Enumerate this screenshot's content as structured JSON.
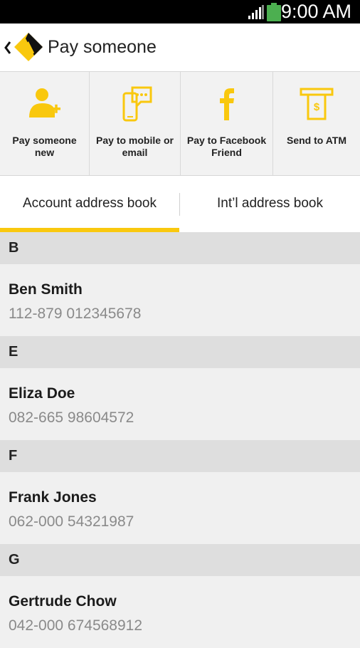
{
  "status_bar": {
    "time": "9:00 AM"
  },
  "app_bar": {
    "title": "Pay someone"
  },
  "actions": [
    {
      "label": "Pay someone new",
      "icon": "add-person-icon"
    },
    {
      "label": "Pay to mobile or email",
      "icon": "mobile-chat-icon"
    },
    {
      "label": "Pay to Facebook Friend",
      "icon": "facebook-icon"
    },
    {
      "label": "Send to ATM",
      "icon": "atm-cash-icon"
    }
  ],
  "tabs": {
    "account": "Account address book",
    "international": "Int’l address book",
    "selected": "account"
  },
  "sections": [
    {
      "letter": "B",
      "contacts": [
        {
          "name": "Ben Smith",
          "account": "112-879 012345678"
        }
      ]
    },
    {
      "letter": "E",
      "contacts": [
        {
          "name": "Eliza Doe",
          "account": "082-665 98604572"
        }
      ]
    },
    {
      "letter": "F",
      "contacts": [
        {
          "name": "Frank Jones",
          "account": "062-000 54321987"
        }
      ]
    },
    {
      "letter": "G",
      "contacts": [
        {
          "name": "Gertrude Chow",
          "account": "042-000 674568912"
        }
      ]
    }
  ],
  "colors": {
    "accent": "#f9c80e",
    "status_bar": "#000000",
    "battery": "#4caf50"
  }
}
